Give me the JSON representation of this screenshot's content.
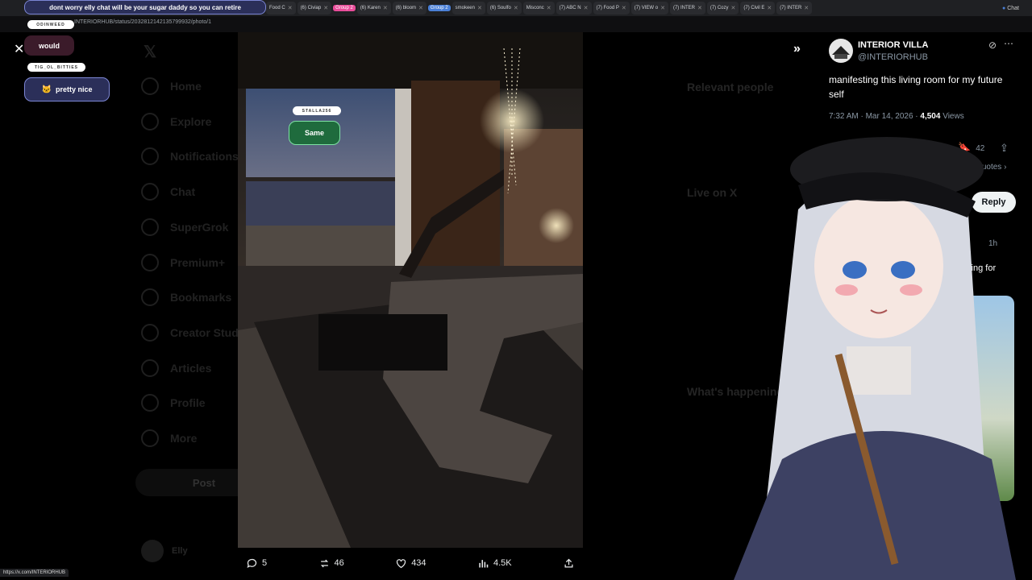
{
  "browser": {
    "tabs": [
      {
        "label": "Food C"
      },
      {
        "label": "(6) Civiap"
      },
      {
        "group": "Group 2",
        "color": "#e94c9a"
      },
      {
        "label": "(6) Karen"
      },
      {
        "label": "(6) bloom"
      },
      {
        "group": "Group 2",
        "color": "#4a7fd6"
      },
      {
        "label": "smokeen"
      },
      {
        "label": "(6) Soulfo"
      },
      {
        "label": "Misconc"
      },
      {
        "label": "(7) ABC N"
      },
      {
        "label": "(7) Food P"
      },
      {
        "label": "(7) VIEW o"
      },
      {
        "label": "(7) INTER"
      },
      {
        "label": "(7) Cozy"
      },
      {
        "label": "(7) Civil E"
      },
      {
        "label": "(7) INTER"
      }
    ],
    "url": "INTERIORHUB/status/2032812142135799932/photo/1",
    "chat_label": "Chat",
    "status_url": "https://x.com/INTERIORHUB"
  },
  "stream_overlay": {
    "messages": [
      {
        "user": "",
        "text": "dont worry elly chat will be your sugar daddy so you can retire"
      },
      {
        "user": "ODINWEED",
        "text": "would"
      },
      {
        "user": "TIG_OL_BITTIES",
        "text": "pretty nice"
      },
      {
        "user": "STALLA256",
        "text": "Same"
      }
    ]
  },
  "x_nav": {
    "items": [
      "Home",
      "Explore",
      "Notifications",
      "Chat",
      "SuperGrok",
      "Premium+",
      "Bookmarks",
      "Creator Studio",
      "Articles",
      "Profile",
      "More"
    ],
    "post_label": "Post",
    "user_name": "Elly"
  },
  "photo_viewer": {
    "actions": {
      "replies": "5",
      "reposts": "46",
      "likes": "434",
      "views": "4.5K"
    }
  },
  "right_dim": {
    "relevant_people": "Relevant people",
    "live_on_x": "Live on X",
    "whats_happening": "What's happening"
  },
  "tweet": {
    "display_name": "INTERIOR VILLA",
    "handle": "@INTERIORHUB",
    "text": "manifesting this living room for my future self",
    "time": "7:32 AM · Mar 14, 2026 · ",
    "views_count": "4,504",
    "views_label": " Views",
    "bookmarks": "42",
    "view_quotes": "View quotes ›",
    "reply_label": "Reply",
    "reply_time": "1h",
    "reply_snippet": "sting for"
  },
  "colors": {
    "accent_green": "#3ec46d",
    "bubble": "#3b1b2a"
  }
}
